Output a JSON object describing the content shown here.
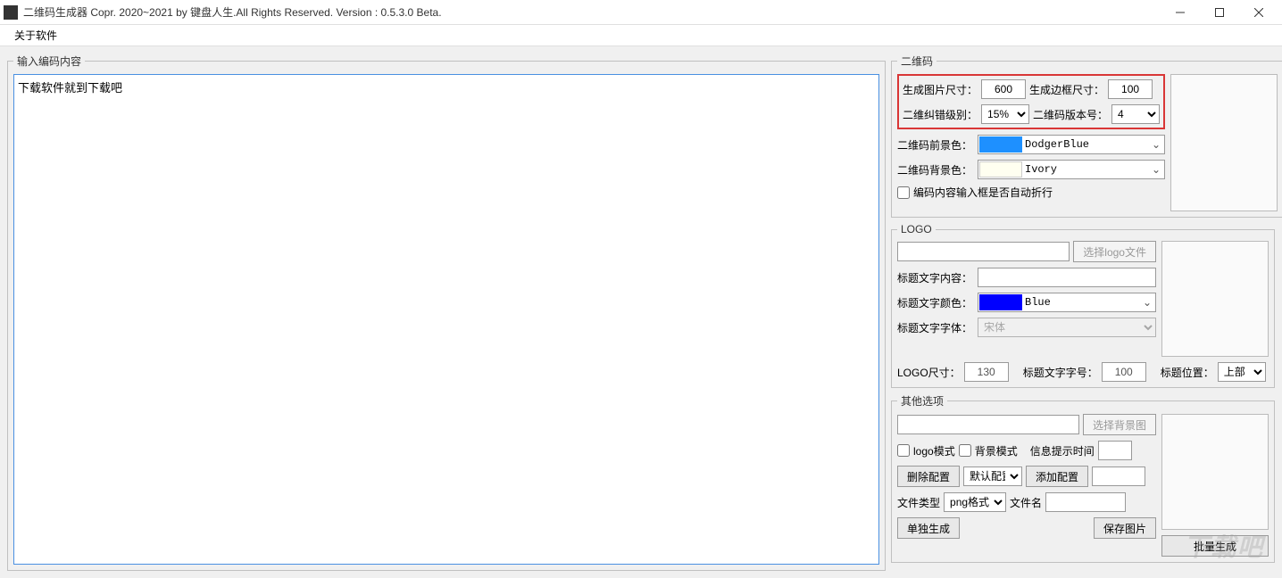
{
  "window": {
    "title": "二维码生成器  Copr. 2020~2021 by 键盘人生.All Rights Reserved.   Version : 0.5.3.0 Beta."
  },
  "menu": {
    "about": "关于软件"
  },
  "input_panel": {
    "legend": "输入编码内容",
    "content": "下载软件就到下载吧"
  },
  "qrcode": {
    "legend": "二维码",
    "img_size_label": "生成图片尺寸：",
    "img_size_value": "600",
    "border_size_label": "生成边框尺寸：",
    "border_size_value": "100",
    "ec_level_label": "二维纠错级别：",
    "ec_level_value": "15%",
    "version_label": "二维码版本号：",
    "version_value": "4",
    "fg_label": "二维码前景色：",
    "fg_color_name": "DodgerBlue",
    "fg_color_hex": "#1E90FF",
    "bg_label": "二维码背景色：",
    "bg_color_name": "Ivory",
    "bg_color_hex": "#FFFFF0",
    "wrap_checkbox": "编码内容输入框是否自动折行"
  },
  "logo": {
    "legend": "LOGO",
    "select_btn": "选择logo文件",
    "title_text_label": "标题文字内容：",
    "title_text_value": "",
    "title_color_label": "标题文字颜色：",
    "title_color_name": "Blue",
    "title_color_hex": "#0000FF",
    "title_font_label": "标题文字字体：",
    "title_font_value": "宋体",
    "logo_size_label": "LOGO尺寸：",
    "logo_size_value": "130",
    "title_font_size_label": "标题文字字号：",
    "title_font_size_value": "100",
    "title_pos_label": "标题位置：",
    "title_pos_value": "上部"
  },
  "other": {
    "legend": "其他选项",
    "select_bg_btn": "选择背景图",
    "logo_mode": "logo模式",
    "bg_mode": "背景模式",
    "msg_time_label": "信息提示时间",
    "msg_time_value": "",
    "delete_config": "删除配置",
    "default_config": "默认配置",
    "add_config": "添加配置",
    "config_name_value": "",
    "file_type_label": "文件类型",
    "file_type_value": "png格式",
    "file_name_label": "文件名",
    "file_name_value": "",
    "single_gen": "单独生成",
    "save_img": "保存图片",
    "batch_gen": "批量生成"
  },
  "watermark": "下载吧"
}
